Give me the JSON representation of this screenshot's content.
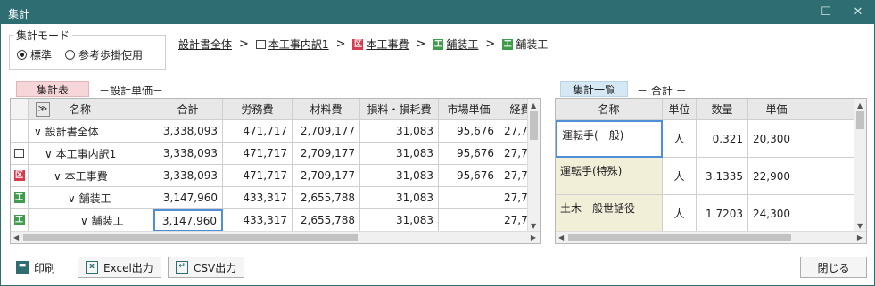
{
  "window": {
    "title": "集計",
    "controls": {
      "minimize": "—",
      "maximize": "☐",
      "close": "✕"
    }
  },
  "mode_group": {
    "legend": "集計モード",
    "options": [
      "標準",
      "参考歩掛使用"
    ],
    "selected": "標準"
  },
  "breadcrumb": [
    {
      "icon": "document-icon",
      "label": "設計書全体"
    },
    {
      "icon": "document-outline-icon",
      "label": "本工事内訳1"
    },
    {
      "icon": "red-ku-icon",
      "label": "本工事費",
      "icon_text": "区"
    },
    {
      "icon": "green-ko-icon",
      "label": "舗装工",
      "icon_text": "工"
    },
    {
      "icon": "green-ko-icon",
      "label": "舗装工",
      "icon_text": "工"
    }
  ],
  "breadcrumb_sep": ">",
  "left_panel": {
    "tag": "集計表",
    "subtitle": "－設計単価－",
    "filter_icon": "≫",
    "columns": [
      "名称",
      "合計",
      "労務費",
      "材料費",
      "損料・損耗費",
      "市場単価",
      "経費"
    ],
    "rows": [
      {
        "icon": "",
        "icon_text": "",
        "name": "∨ 設計書全体",
        "values": [
          "3,338,093",
          "471,717",
          "2,709,177",
          "31,083",
          "95,676",
          "27,7"
        ]
      },
      {
        "icon": "doc",
        "icon_text": "",
        "name": "∨ 本工事内訳1",
        "values": [
          "3,338,093",
          "471,717",
          "2,709,177",
          "31,083",
          "95,676",
          "27,7"
        ]
      },
      {
        "icon": "red",
        "icon_text": "区",
        "name": "∨ 本工事費",
        "values": [
          "3,338,093",
          "471,717",
          "2,709,177",
          "31,083",
          "95,676",
          "27,7"
        ]
      },
      {
        "icon": "green",
        "icon_text": "工",
        "name": "∨ 舗装工",
        "values": [
          "3,147,960",
          "433,317",
          "2,655,788",
          "31,083",
          "",
          "27,7"
        ]
      },
      {
        "icon": "green",
        "icon_text": "工",
        "name": "∨ 舗装工",
        "values": [
          "3,147,960",
          "433,317",
          "2,655,788",
          "31,083",
          "",
          "27,7"
        ]
      }
    ]
  },
  "right_panel": {
    "tag": "集計一覧",
    "subtitle": "－ 合計 －",
    "columns": [
      "名称",
      "単位",
      "数量",
      "単価"
    ],
    "rows": [
      {
        "name": "運転手(一般)",
        "unit": "人",
        "qty": "0.321",
        "price": "20,300"
      },
      {
        "name": "運転手(特殊)",
        "unit": "人",
        "qty": "3.1335",
        "price": "22,900"
      },
      {
        "name": "土木一般世話役",
        "unit": "人",
        "qty": "1.7203",
        "price": "24,300"
      }
    ]
  },
  "buttons": {
    "print": "印刷",
    "excel": "Excel出力",
    "csv": "CSV出力",
    "close": "閉じる"
  },
  "scroll_arrows": {
    "up": "▲",
    "down": "▼",
    "left": "◀",
    "right": "▶"
  },
  "colors": {
    "titlebar": "#2e6e73",
    "tag_pink": "#f7d6d9",
    "tag_blue": "#d5e8f3",
    "row_highlight": "#f2efd9"
  }
}
